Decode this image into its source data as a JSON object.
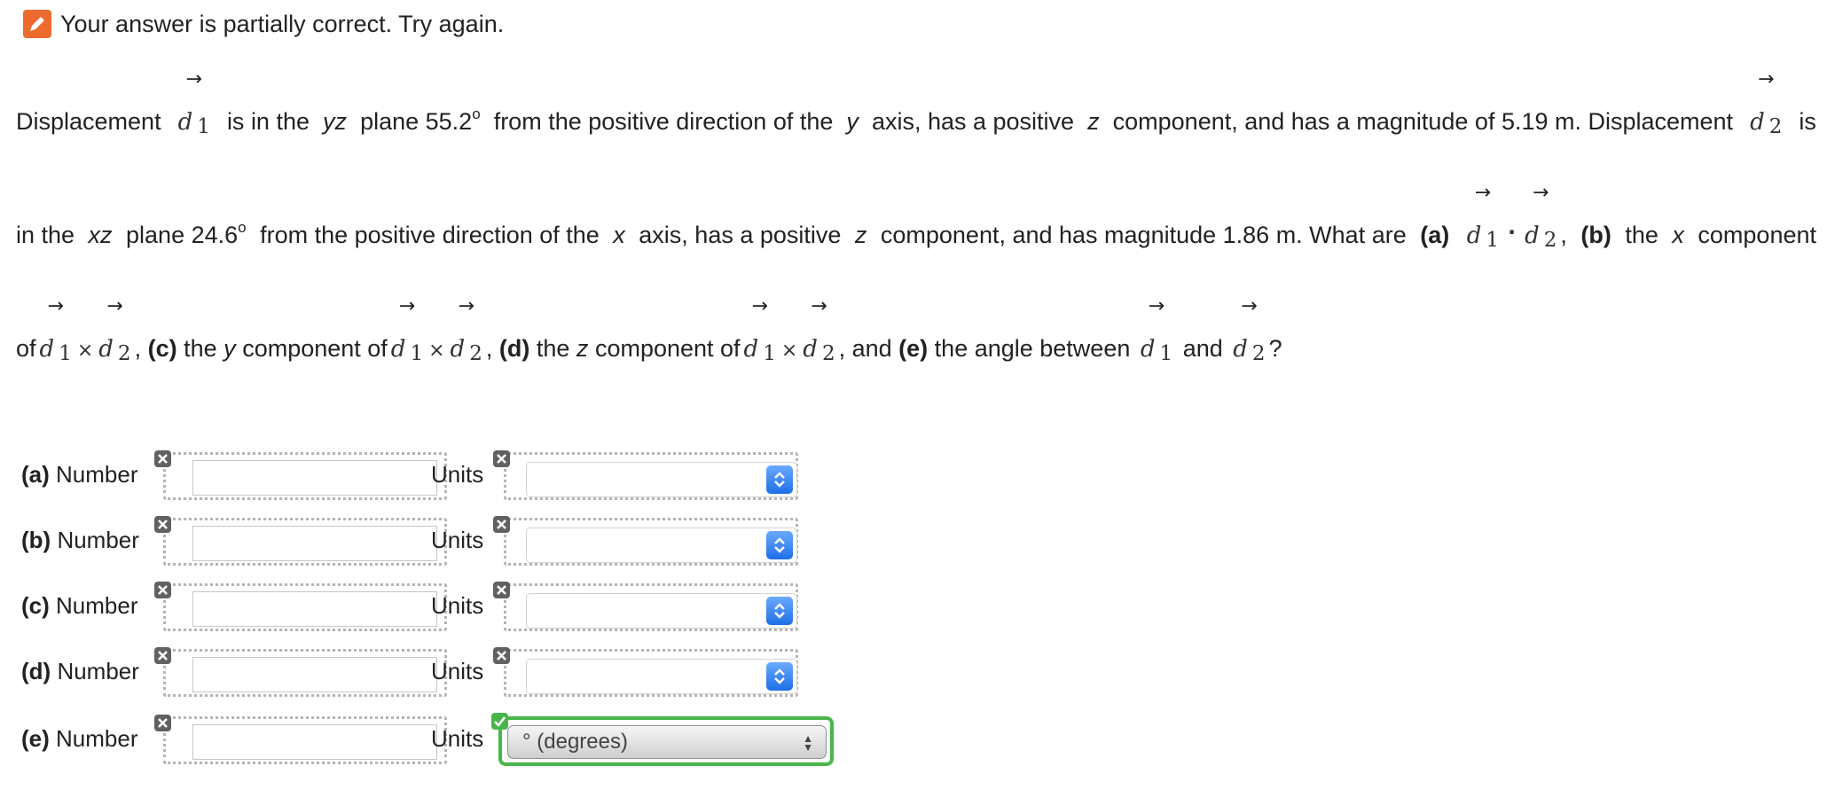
{
  "feedback": {
    "message": "Your answer is partially correct.  Try again.",
    "status_color": "#ec6a2d"
  },
  "problem": {
    "intro": "Displacement",
    "vector1": "d",
    "vector1_sub": "1",
    "vector2": "d",
    "vector2_sub": "2",
    "d1_desc_a": "is in the",
    "d1_plane": "yz",
    "d1_desc_b": "plane 55.2",
    "degree_sup": "o",
    "d1_desc_c": "from the positive direction of the",
    "d1_axis": "y",
    "d1_desc_d": "axis, has a positive",
    "d1_comp": "z",
    "d1_desc_e": "component, and has a magnitude of 5.19 m. Displacement",
    "d2_is": "is",
    "d2_desc_a": "in the",
    "d2_plane": "xz",
    "d2_desc_b": "plane 24.6",
    "d2_desc_c": "from the positive direction of the",
    "d2_axis": "x",
    "d2_desc_d": "axis, has a positive",
    "d2_comp": "z",
    "d2_desc_e": "component, and has magnitude 1.86 m. What are",
    "part_a": "(a)",
    "comma": ",",
    "part_b": "(b)",
    "part_b_text": "the",
    "part_b_axis": "x",
    "part_b_tail": "component",
    "of": "of",
    "part_c": "(c)",
    "part_c_text": "the",
    "part_c_axis": "y",
    "part_c_tail": "component of",
    "part_d": "(d)",
    "part_d_text": "the",
    "part_d_axis": "z",
    "part_d_tail": "component of",
    "and_text": ", and",
    "part_e": "(e)",
    "part_e_text": "the angle between",
    "and_word": "and",
    "question_mark": "?",
    "dot_op": "·",
    "cross_op": "×",
    "arrow": "→"
  },
  "answers": [
    {
      "part": "(a)",
      "label": "Number",
      "value": "",
      "units_label": "Units",
      "unit_value": "",
      "units_status": "incorrect"
    },
    {
      "part": "(b)",
      "label": "Number",
      "value": "",
      "units_label": "Units",
      "unit_value": "",
      "units_status": "incorrect"
    },
    {
      "part": "(c)",
      "label": "Number",
      "value": "",
      "units_label": "Units",
      "unit_value": "",
      "units_status": "incorrect"
    },
    {
      "part": "(d)",
      "label": "Number",
      "value": "",
      "units_label": "Units",
      "unit_value": "",
      "units_status": "incorrect"
    },
    {
      "part": "(e)",
      "label": "Number",
      "value": "",
      "units_label": "Units",
      "unit_value": "° (degrees)",
      "units_status": "correct"
    }
  ],
  "colors": {
    "incorrect_badge": "#616161",
    "correct_badge": "#49b64a",
    "select_button": "#1e6fe8"
  },
  "icons": {
    "feedback": "pencil-icon",
    "incorrect": "x-icon",
    "correct": "check-icon",
    "select": "chevron-updown-icon"
  }
}
